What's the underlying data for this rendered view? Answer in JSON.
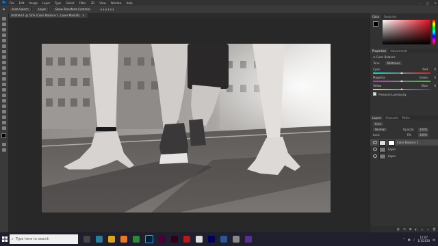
{
  "app": {
    "logo": "Ps"
  },
  "menu": [
    "File",
    "Edit",
    "Image",
    "Layer",
    "Type",
    "Select",
    "Filter",
    "3D",
    "View",
    "Window",
    "Help"
  ],
  "options_bar": {
    "items": [
      "Auto-Select:",
      "Layer",
      "Show Transform Controls"
    ]
  },
  "document_tab": {
    "title": "Untitled-1 @ 53% (Color Balance 1, Layer Mask/8)",
    "close": "×"
  },
  "panels": {
    "color_tabs": [
      "Color",
      "Swatches"
    ],
    "properties_tabs": [
      "Properties",
      "Adjustments"
    ],
    "properties_title": "Color Balance",
    "tone_label": "Tone:",
    "tone_value": "Midtones",
    "sliders": [
      {
        "left": "Cyan",
        "right": "Red",
        "value": "0"
      },
      {
        "left": "Magenta",
        "right": "Green",
        "value": "0"
      },
      {
        "left": "Yellow",
        "right": "Blue",
        "value": "0"
      }
    ],
    "preserve_label": "Preserve Luminosity",
    "layers_tabs": [
      "Layers",
      "Channels",
      "Paths"
    ],
    "blend_mode": "Normal",
    "opacity_label": "Opacity:",
    "opacity_value": "100%",
    "lock_label": "Lock:",
    "fill_label": "Fill:",
    "fill_value": "100%",
    "layers": [
      {
        "name": "Color Balance 1"
      },
      {
        "name": "Layer"
      },
      {
        "name": "Layer"
      }
    ]
  },
  "taskbar": {
    "search_placeholder": "Type here to search",
    "time": "12:07",
    "date": "1/1/2019"
  },
  "colors": {
    "accent": "#31a8ff",
    "swatch_fg": "#000000",
    "swatch_bg": "#ffffff"
  }
}
